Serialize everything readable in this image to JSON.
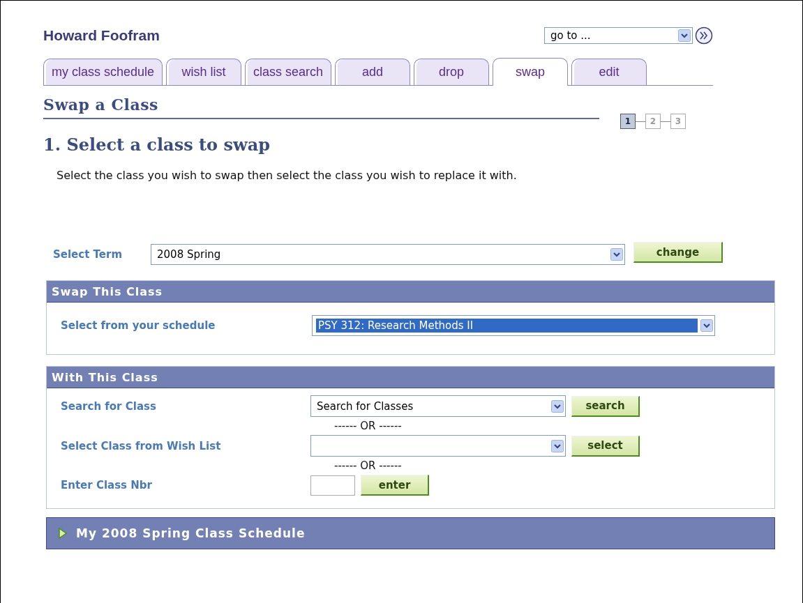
{
  "user": {
    "name": "Howard Foofram"
  },
  "goto": {
    "value": "go to ..."
  },
  "tabs": [
    {
      "label": "my class schedule",
      "selected": false
    },
    {
      "label": "wish list",
      "selected": false
    },
    {
      "label": "class search",
      "selected": false
    },
    {
      "label": "add",
      "selected": false
    },
    {
      "label": "drop",
      "selected": false
    },
    {
      "label": "swap",
      "selected": true
    },
    {
      "label": "edit",
      "selected": false
    }
  ],
  "page_title": "Swap a Class",
  "steps": [
    {
      "label": "1",
      "selected": true
    },
    {
      "label": "2",
      "selected": false
    },
    {
      "label": "3",
      "selected": false
    }
  ],
  "step_heading": "1. Select a class to swap",
  "instructions": "Select the class you wish to swap then select the class you wish to replace it with.",
  "term": {
    "label": "Select Term",
    "value": "2008 Spring",
    "button": "change"
  },
  "swap_section": {
    "title": "Swap This Class",
    "label": "Select from your schedule",
    "value": "PSY 312: Research Methods II",
    "highlighted": true
  },
  "with_section": {
    "title": "With This Class",
    "rows": [
      {
        "kind": "dropdown",
        "label": "Search for Class",
        "value": "Search for Classes",
        "button": "search"
      },
      {
        "kind": "separator",
        "text": "------ OR ------"
      },
      {
        "kind": "dropdown",
        "label": "Select Class from Wish List",
        "button": "select"
      },
      {
        "kind": "separator",
        "text": "------ OR ------"
      },
      {
        "kind": "input",
        "label": "Enter Class Nbr",
        "button": "enter"
      }
    ]
  },
  "schedule_section": {
    "title": "My 2008 Spring Class Schedule",
    "expanded": false
  }
}
